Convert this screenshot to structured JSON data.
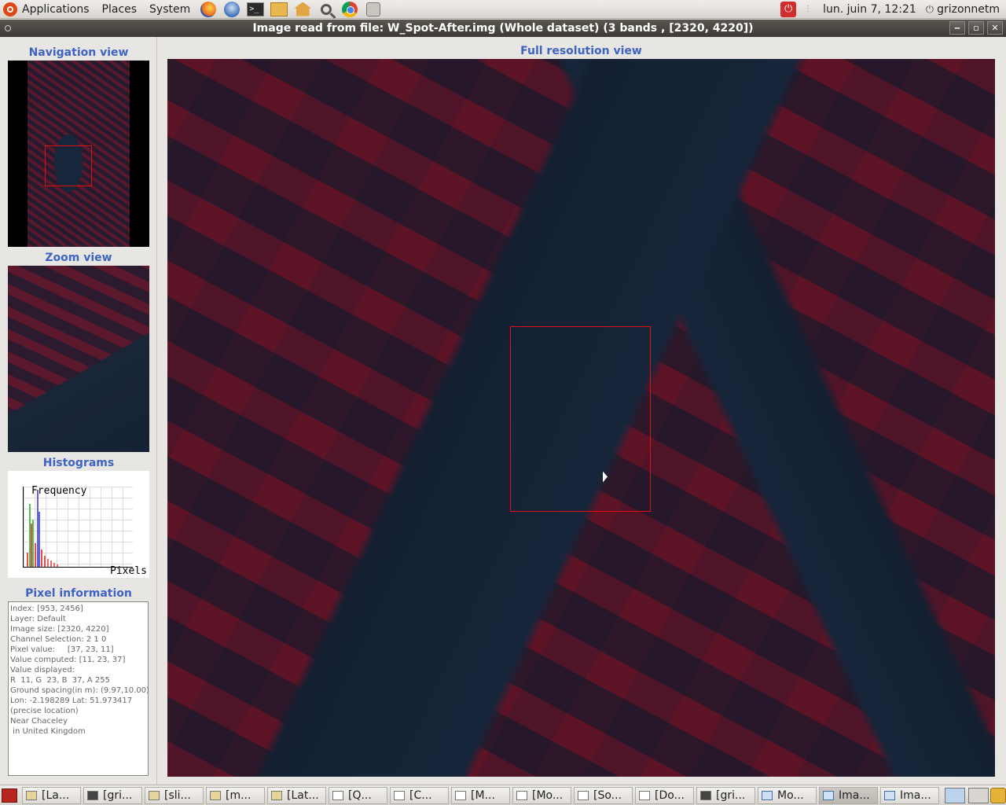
{
  "top_panel": {
    "menus": [
      "Applications",
      "Places",
      "System"
    ],
    "clock": "lun. juin  7, 12:21",
    "user": "grizonnetm"
  },
  "window": {
    "title": "Image read from file: W_Spot-After.img (Whole dataset) (3 bands , [2320, 4220])"
  },
  "left": {
    "navigation_title": "Navigation view",
    "zoom_title": "Zoom view",
    "histograms_title": "Histograms",
    "hist_y_label": "Frequency",
    "hist_x_label": "Pixels",
    "pixel_info_title": "Pixel information",
    "pixel_info_lines": [
      "Index: [953, 2456]",
      "Layer: Default",
      "Image size: [2320, 4220]",
      "Channel Selection: 2 1 0",
      "Pixel value:     [37, 23, 11]",
      "Value computed: [11, 23, 37]",
      "Value displayed:",
      "R  11, G  23, B  37, A 255",
      "Ground spacing(in m): (9.97,10.00)",
      "Lon: -2.198289 Lat: 51.973417",
      "(precise location)",
      "Near Chaceley",
      " in United Kingdom"
    ]
  },
  "main": {
    "full_title": "Full resolution view"
  },
  "taskbar": {
    "tasks": [
      {
        "label": "[La...",
        "icon": "folder"
      },
      {
        "label": "[gri...",
        "icon": "terminal"
      },
      {
        "label": "[sli...",
        "icon": "folder"
      },
      {
        "label": "[m...",
        "icon": "folder"
      },
      {
        "label": "[Lat...",
        "icon": "folder"
      },
      {
        "label": "[Q...",
        "icon": "document"
      },
      {
        "label": "[C...",
        "icon": "editor"
      },
      {
        "label": "[M...",
        "icon": "editor"
      },
      {
        "label": "[Mo...",
        "icon": "document"
      },
      {
        "label": "[So...",
        "icon": "editor"
      },
      {
        "label": "[Do...",
        "icon": "document"
      },
      {
        "label": "[gri...",
        "icon": "terminal"
      },
      {
        "label": "Mo...",
        "icon": "window"
      },
      {
        "label": "Ima...",
        "icon": "window"
      },
      {
        "label": "Ima...",
        "icon": "window"
      }
    ]
  },
  "colors": {
    "accent_title": "#3e63c4",
    "frame_red": "#e01010"
  }
}
